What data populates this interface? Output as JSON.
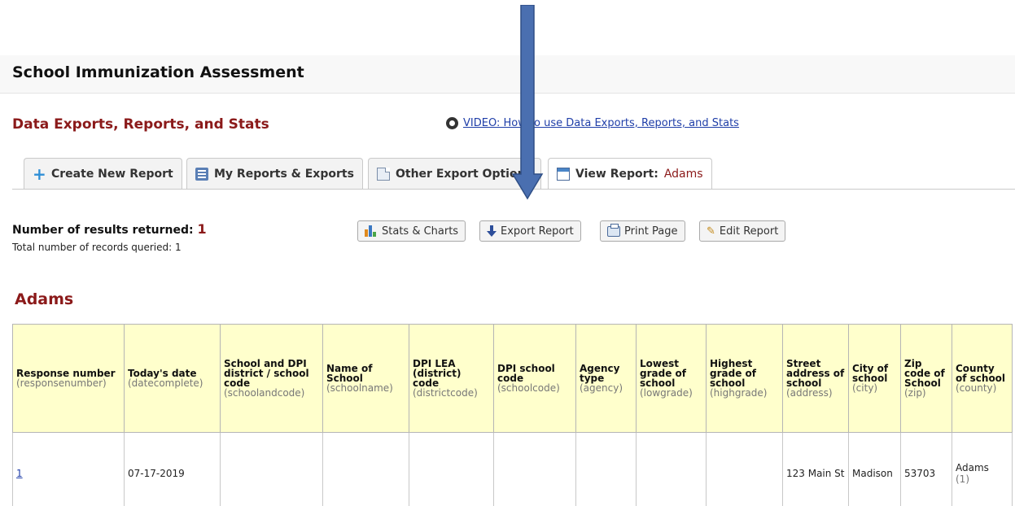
{
  "project": {
    "title": "School Immunization Assessment"
  },
  "section": {
    "title": "Data Exports, Reports, and Stats",
    "video_link": "VIDEO: How to use Data Exports, Reports, and Stats"
  },
  "tabs": [
    {
      "label": "Create New Report",
      "icon": "plus-icon"
    },
    {
      "label": "My Reports & Exports",
      "icon": "reports-icon"
    },
    {
      "label": "Other Export Options",
      "icon": "document-icon"
    },
    {
      "label": "View Report:",
      "sub": "Adams",
      "icon": "window-icon"
    }
  ],
  "results": {
    "label": "Number of results returned:",
    "count": "1",
    "records_label": "Total number of records queried: 1"
  },
  "buttons": {
    "stats": "Stats & Charts",
    "export": "Export Report",
    "print": "Print Page",
    "edit": "Edit Report"
  },
  "report": {
    "title": "Adams",
    "columns": [
      {
        "label": "Response number",
        "field": "(responsenumber)"
      },
      {
        "label": "Today's date",
        "field": "(datecomplete)"
      },
      {
        "label": "School and DPI district / school code",
        "field": "(schoolandcode)"
      },
      {
        "label": "Name of School",
        "field": "(schoolname)"
      },
      {
        "label": "DPI LEA (district) code",
        "field": "(districtcode)"
      },
      {
        "label": "DPI school code",
        "field": "(schoolcode)"
      },
      {
        "label": "Agency type",
        "field": "(agency)"
      },
      {
        "label": "Lowest grade of school",
        "field": "(lowgrade)"
      },
      {
        "label": "Highest grade of school",
        "field": "(highgrade)"
      },
      {
        "label": "Street address of school",
        "field": "(address)"
      },
      {
        "label": "City of school",
        "field": "(city)"
      },
      {
        "label": "Zip code of School",
        "field": "(zip)"
      },
      {
        "label": "County of school",
        "field": "(county)"
      }
    ],
    "rows": [
      {
        "responsenumber": "1",
        "datecomplete": "07-17-2019",
        "schoolandcode": "",
        "schoolname": "",
        "districtcode": "",
        "schoolcode": "",
        "agency": "",
        "lowgrade": "",
        "highgrade": "",
        "address": "123 Main St",
        "city": "Madison",
        "zip": "53703",
        "county": "Adams",
        "county_code": "(1)"
      }
    ]
  },
  "colors": {
    "accent": "#8b1a1a",
    "header_bg": "#ffffcc",
    "link": "#1f3ea8",
    "arrow_fill": "#4a6fb0"
  }
}
